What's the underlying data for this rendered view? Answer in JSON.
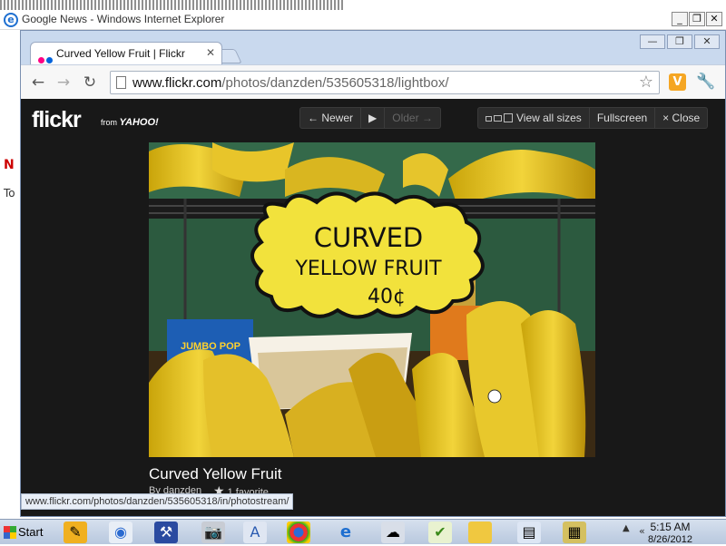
{
  "ie_window": {
    "title": "Google News - Windows Internet Explorer",
    "left_fragments": [
      "N",
      "To"
    ],
    "controls": [
      "_",
      "❐",
      "✕"
    ]
  },
  "chrome": {
    "tab_title": "Curved Yellow Fruit | Flickr",
    "tab_close": "✕",
    "url_host": "www.flickr.com",
    "url_path": "/photos/danzden/535605318/lightbox/",
    "status_url": "www.flickr.com/photos/danzden/535605318/in/photostream/",
    "window_controls": [
      "—",
      "❐",
      "✕"
    ],
    "colors": {
      "flickr_pink": "#ff0084",
      "flickr_blue": "#0063dc"
    }
  },
  "flickr": {
    "logo": "flickr",
    "logo_from": "from",
    "logo_yahoo": "YAHOO!",
    "nav": {
      "newer": "← Newer",
      "play": "▶",
      "older": "Older →"
    },
    "actions": {
      "view_all_sizes": "View all sizes",
      "fullscreen": "Fullscreen",
      "close": "× Close"
    },
    "photo": {
      "sign_line1": "CURVED",
      "sign_line2": "YELLOW  FRUIT",
      "sign_line3": "40¢",
      "box_text": "JUMBO POP"
    },
    "caption": {
      "title": "Curved Yellow Fruit",
      "by": "By danzden",
      "favorites": "1 favorite"
    }
  },
  "taskbar": {
    "start": "Start",
    "time": "5:15 AM",
    "date": "8/26/2012"
  }
}
